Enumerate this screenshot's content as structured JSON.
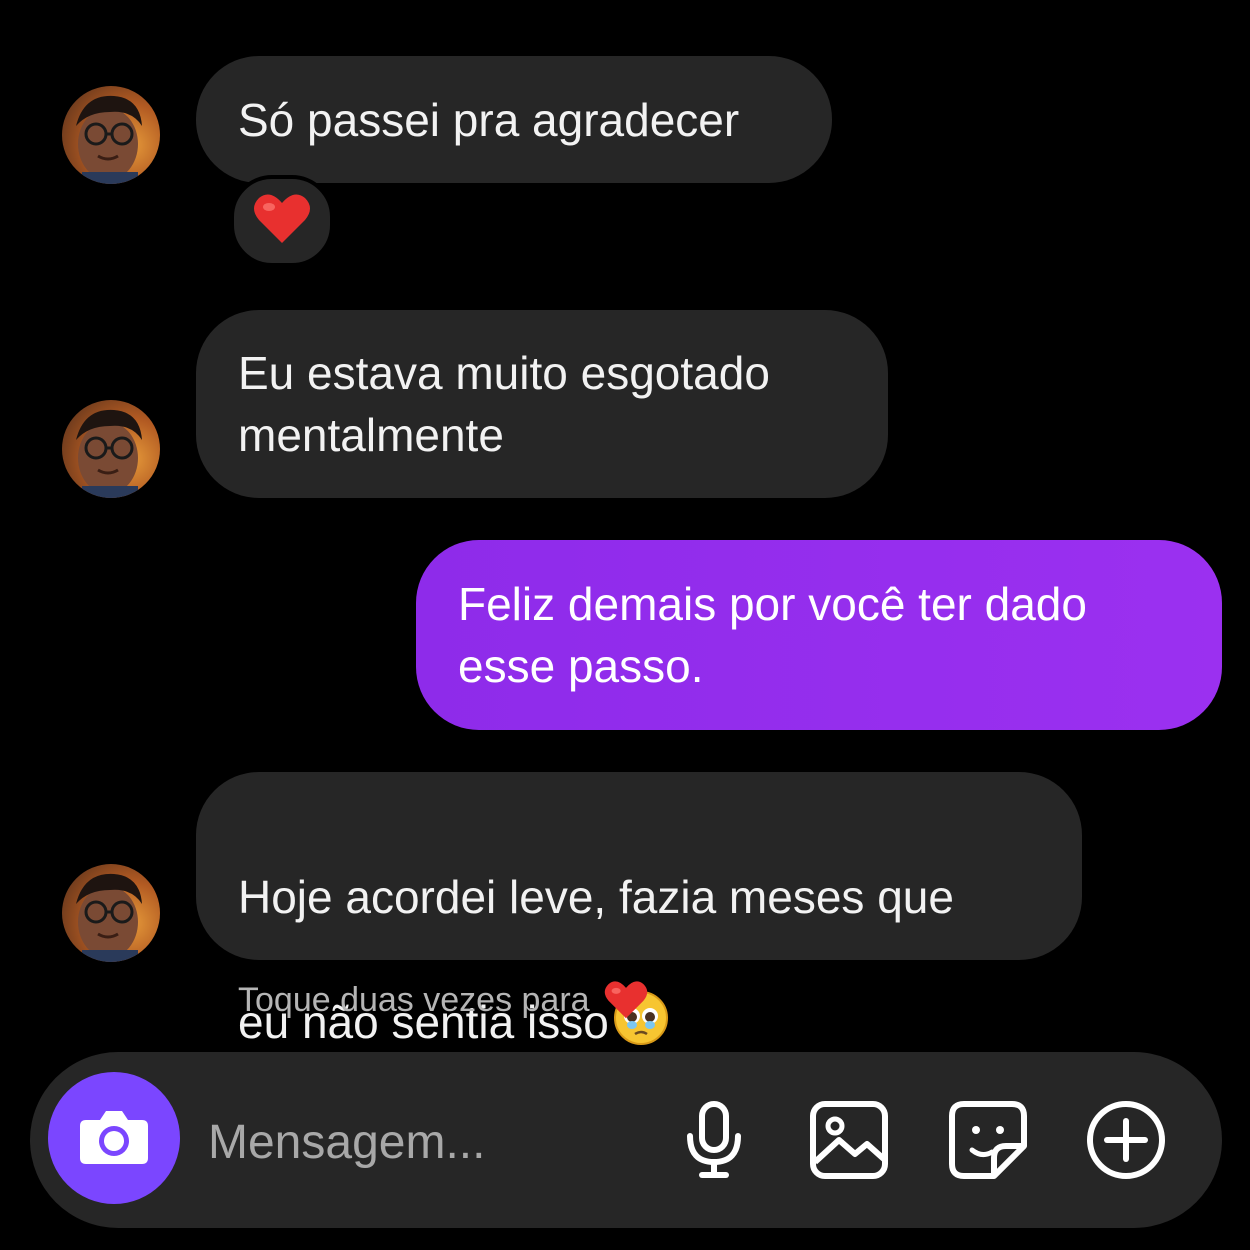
{
  "colors": {
    "background": "#000000",
    "received_bubble": "#262626",
    "sent_bubble": "#9b30f0",
    "camera_button": "#7b46ff",
    "heart": "#e8302f"
  },
  "messages": [
    {
      "direction": "received",
      "text": "Só passei pra agradecer",
      "reaction": "heart-icon"
    },
    {
      "direction": "received",
      "text": "Eu estava muito esgotado\nmentalmente"
    },
    {
      "direction": "sent",
      "text": "Feliz demais por você ter dado\nesse passo."
    },
    {
      "direction": "received",
      "text": "Hoje acordei leve, fazia meses que\neu não sentia isso",
      "trailing_emoji": "teary-face-emoji"
    }
  ],
  "hint": {
    "text": "Toque duas vezes para",
    "icon": "heart-icon"
  },
  "composer": {
    "placeholder": "Mensagem...",
    "camera_icon": "camera-icon",
    "tools": [
      "microphone-icon",
      "gallery-icon",
      "sticker-icon",
      "plus-circle-icon"
    ]
  }
}
